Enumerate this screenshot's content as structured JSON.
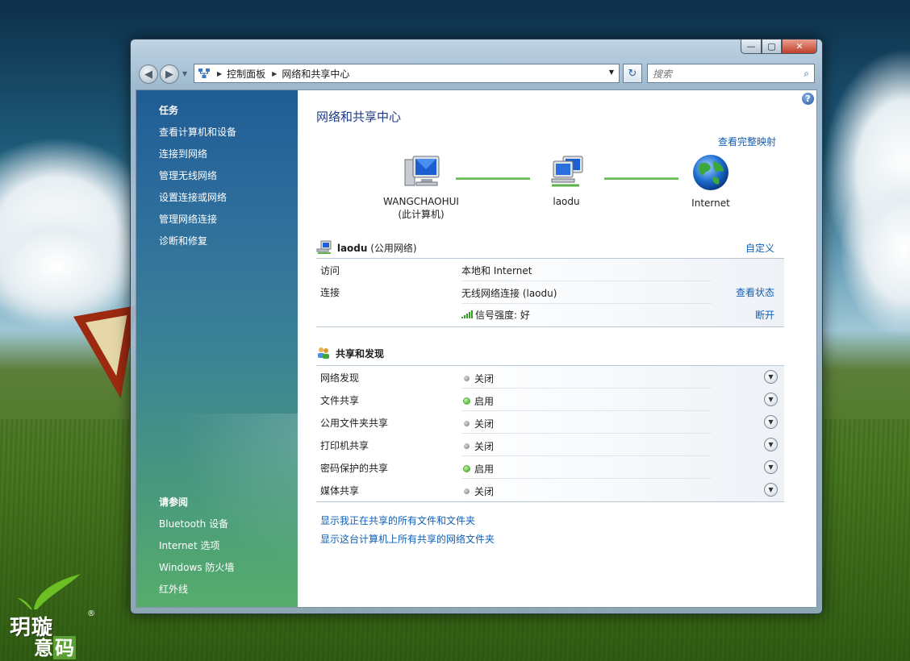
{
  "window": {
    "minimize_glyph": "—",
    "maximize_glyph": "▢",
    "close_glyph": "✕"
  },
  "address": {
    "crumbs": [
      "控制面板",
      "网络和共享中心"
    ],
    "search_placeholder": "搜索"
  },
  "sidebar": {
    "tasks_heading": "任务",
    "tasks": [
      "查看计算机和设备",
      "连接到网络",
      "管理无线网络",
      "设置连接或网络",
      "管理网络连接",
      "诊断和修复"
    ],
    "see_also_heading": "请参阅",
    "see_also": [
      "Bluetooth 设备",
      "Internet 选项",
      "Windows 防火墙",
      "红外线"
    ]
  },
  "main": {
    "title": "网络和共享中心",
    "full_map_link": "查看完整映射",
    "map": {
      "computer_name": "WANGCHAOHUI",
      "computer_sub": "(此计算机)",
      "network_name": "laodu",
      "internet": "Internet"
    },
    "network": {
      "name": "laodu",
      "type": "(公用网络)",
      "customize": "自定义",
      "access_label": "访问",
      "access_value": "本地和 Internet",
      "connection_label": "连接",
      "connection_value": "无线网络连接 (laodu)",
      "view_status": "查看状态",
      "signal_label": "信号强度: 好",
      "disconnect": "断开"
    },
    "sharing": {
      "heading": "共享和发现",
      "items": [
        {
          "label": "网络发现",
          "status": "关闭",
          "on": false
        },
        {
          "label": "文件共享",
          "status": "启用",
          "on": true
        },
        {
          "label": "公用文件夹共享",
          "status": "关闭",
          "on": false
        },
        {
          "label": "打印机共享",
          "status": "关闭",
          "on": false
        },
        {
          "label": "密码保护的共享",
          "status": "启用",
          "on": true
        },
        {
          "label": "媒体共享",
          "status": "关闭",
          "on": false
        }
      ]
    },
    "bottom_links": [
      "显示我正在共享的所有文件和文件夹",
      "显示这台计算机上所有共享的网络文件夹"
    ]
  },
  "watermark": {
    "top": "玥璇",
    "bottom_a": "意",
    "bottom_b": "码",
    "reg": "®"
  },
  "colors": {
    "link": "#0f5fb8",
    "title": "#1e3a8a",
    "status_on": "#2e9a18",
    "status_off": "#7a7a7a"
  }
}
